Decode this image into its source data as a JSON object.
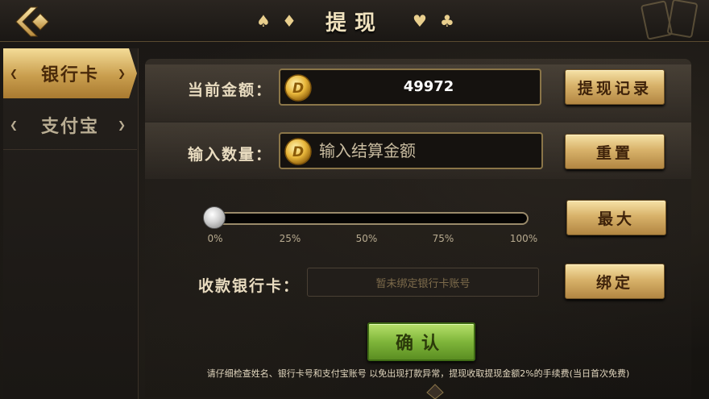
{
  "header": {
    "title": "提现",
    "suits": [
      "♠",
      "♦",
      "♥",
      "♣"
    ]
  },
  "sidebar": {
    "tabs": [
      {
        "label": "银行卡",
        "active": true
      },
      {
        "label": "支付宝",
        "active": false
      }
    ]
  },
  "balance": {
    "label": "当前金额：",
    "value": "49972",
    "history_button": "提现记录"
  },
  "amount": {
    "label": "输入数量：",
    "placeholder": "输入结算金额",
    "reset_button": "重置"
  },
  "slider": {
    "value_fraction": 0,
    "ticks": [
      "0%",
      "25%",
      "50%",
      "75%",
      "100%"
    ],
    "max_button": "最大"
  },
  "bank_card": {
    "label": "收款银行卡：",
    "value": "暂未绑定银行卡账号",
    "bind_button": "绑定"
  },
  "confirm_button": "确认",
  "notice": "请仔细检查姓名、银行卡号和支付宝账号 以免出现打款异常，提现收取提现金额2%的手续费(当日首次免费)",
  "colors": {
    "gold": "#d8b26a",
    "green": "#7fb53a",
    "background": "#141210"
  },
  "icons": {
    "back": "back-arrow-icon",
    "coin": "gold-coin-icon"
  }
}
